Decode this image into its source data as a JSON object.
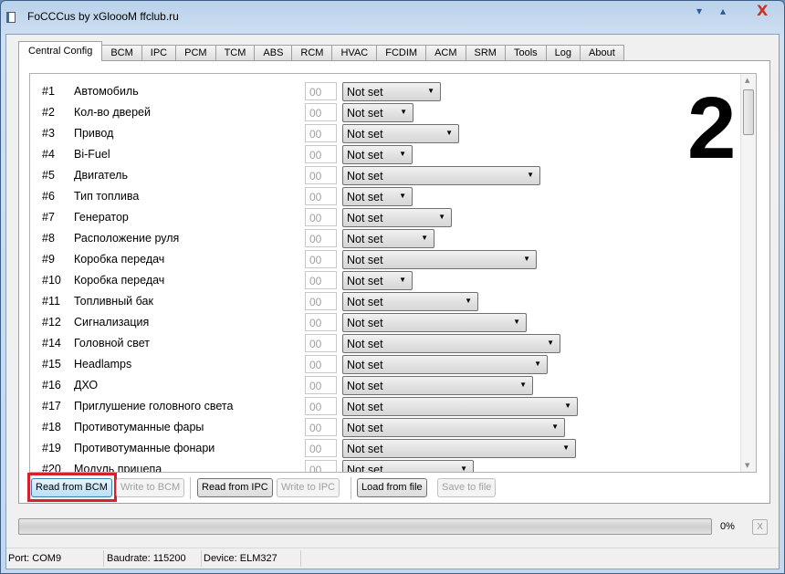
{
  "window": {
    "title": "FoCCCus by xGloooM ffclub.ru"
  },
  "tabs": [
    "Central Config",
    "BCM",
    "IPC",
    "PCM",
    "TCM",
    "ABS",
    "RCM",
    "HVAC",
    "FCDIM",
    "ACM",
    "SRM",
    "Tools",
    "Log",
    "About"
  ],
  "active_tab": "Central Config",
  "annotation": "2",
  "rows": [
    {
      "num": "#1",
      "label": "Автомобиль",
      "hex": "00",
      "value": "Not set"
    },
    {
      "num": "#2",
      "label": "Кол-во дверей",
      "hex": "00",
      "value": "Not set"
    },
    {
      "num": "#3",
      "label": "Привод",
      "hex": "00",
      "value": "Not set"
    },
    {
      "num": "#4",
      "label": "Bi-Fuel",
      "hex": "00",
      "value": "Not set"
    },
    {
      "num": "#5",
      "label": "Двигатель",
      "hex": "00",
      "value": "Not set"
    },
    {
      "num": "#6",
      "label": "Тип топлива",
      "hex": "00",
      "value": "Not set"
    },
    {
      "num": "#7",
      "label": "Генератор",
      "hex": "00",
      "value": "Not set"
    },
    {
      "num": "#8",
      "label": "Расположение руля",
      "hex": "00",
      "value": "Not set"
    },
    {
      "num": "#9",
      "label": "Коробка передач",
      "hex": "00",
      "value": "Not set"
    },
    {
      "num": "#10",
      "label": "Коробка передач",
      "hex": "00",
      "value": "Not set"
    },
    {
      "num": "#11",
      "label": "Топливный бак",
      "hex": "00",
      "value": "Not set"
    },
    {
      "num": "#12",
      "label": "Сигнализация",
      "hex": "00",
      "value": "Not set"
    },
    {
      "num": "#14",
      "label": "Головной свет",
      "hex": "00",
      "value": "Not set"
    },
    {
      "num": "#15",
      "label": "Headlamps",
      "hex": "00",
      "value": "Not set"
    },
    {
      "num": "#16",
      "label": "ДХО",
      "hex": "00",
      "value": "Not set"
    },
    {
      "num": "#17",
      "label": "Приглушение головного света",
      "hex": "00",
      "value": "Not set"
    },
    {
      "num": "#18",
      "label": "Противотуманные фары",
      "hex": "00",
      "value": "Not set"
    },
    {
      "num": "#19",
      "label": "Противотуманные фонари",
      "hex": "00",
      "value": "Not set"
    },
    {
      "num": "#20",
      "label": "Модуль прицепа",
      "hex": "00",
      "value": "Not set"
    }
  ],
  "buttons": {
    "read_bcm": "Read from BCM",
    "write_bcm": "Write to BCM",
    "read_ipc": "Read from IPC",
    "write_ipc": "Write to IPC",
    "load_file": "Load from file",
    "save_file": "Save to file"
  },
  "progress": {
    "value": 0,
    "label": "0%",
    "cancel": "X"
  },
  "status": {
    "port": "Port: COM9",
    "baudrate": "Baudrate: 115200",
    "device": "Device: ELM327"
  },
  "colors": {
    "highlight": "#d8202a",
    "focused_button": "#b8dff6"
  }
}
